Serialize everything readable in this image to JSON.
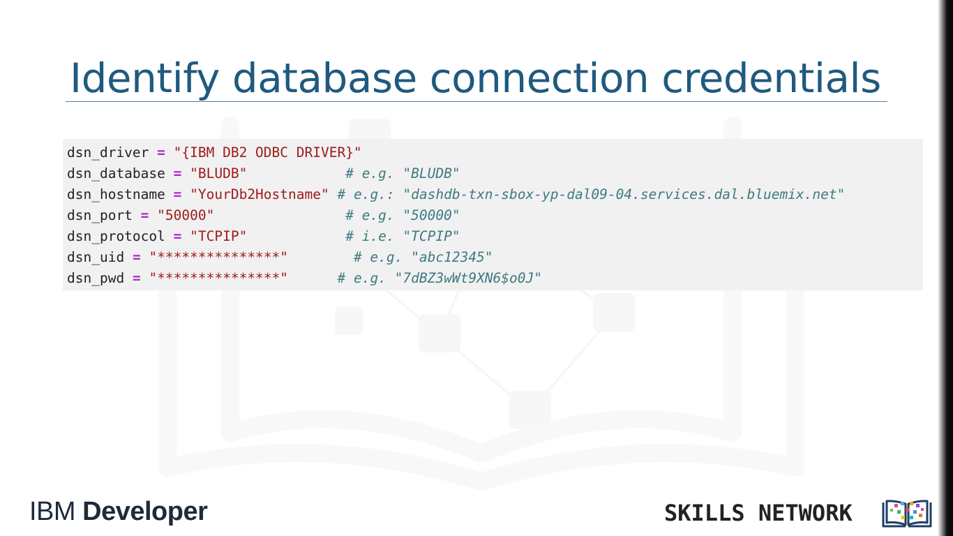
{
  "slide": {
    "title": "Identify database connection credentials"
  },
  "code_lines": [
    {
      "name": "dsn_driver",
      "eq": "=",
      "value": "\"{IBM DB2 ODBC DRIVER}\"",
      "pad": "",
      "comment": ""
    },
    {
      "name": "dsn_database",
      "eq": "=",
      "value": "\"BLUDB\"",
      "pad": "            ",
      "comment": "# e.g. \"BLUDB\""
    },
    {
      "name": "dsn_hostname",
      "eq": "=",
      "value": "\"YourDb2Hostname\"",
      "pad": " ",
      "comment": "# e.g.: \"dashdb-txn-sbox-yp-dal09-04.services.dal.bluemix.net\""
    },
    {
      "name": "dsn_port",
      "eq": "=",
      "value": "\"50000\"",
      "pad": "                ",
      "comment": "# e.g. \"50000\""
    },
    {
      "name": "dsn_protocol",
      "eq": "=",
      "value": "\"TCPIP\"",
      "pad": "            ",
      "comment": "# i.e. \"TCPIP\""
    },
    {
      "name": "dsn_uid",
      "eq": "=",
      "value": "\"***************\"",
      "pad": "        ",
      "comment": "# e.g. \"abc12345\""
    },
    {
      "name": "dsn_pwd",
      "eq": "=",
      "value": "\"***************\"",
      "pad": "      ",
      "comment": "# e.g. \"7dBZ3wWt9XN6$o0J\""
    }
  ],
  "footer": {
    "brand_prefix": "IBM",
    "brand_name": "Developer",
    "network_label": "SKILLS NETWORK"
  },
  "colors": {
    "title": "#1f5a7f",
    "operator": "#a62ec2",
    "string": "#9e1a1a",
    "comment": "#3e7a80",
    "code_background": "#f0f0f0"
  }
}
